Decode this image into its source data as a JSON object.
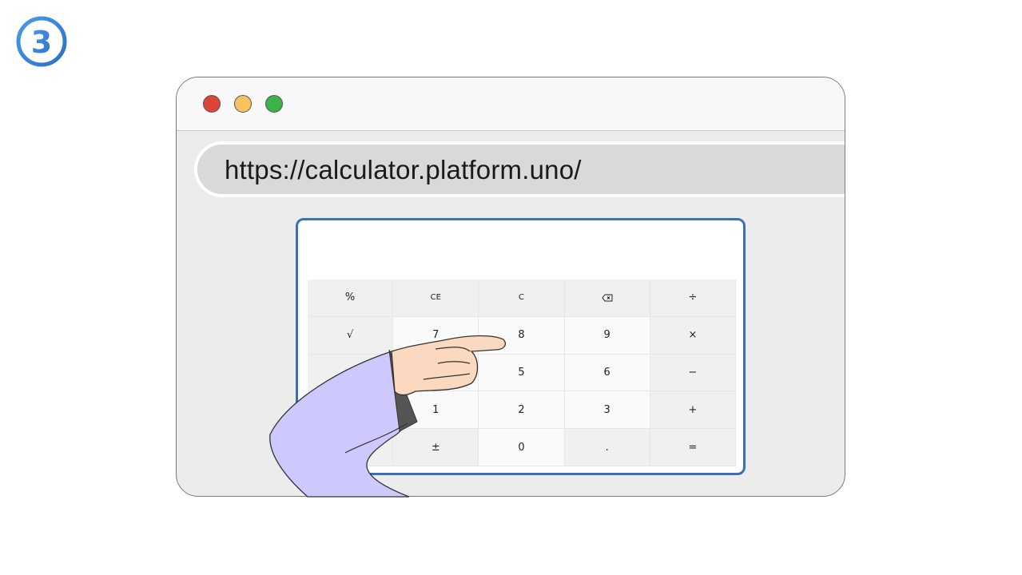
{
  "step": {
    "number": "3",
    "color": "#3a83d8"
  },
  "browser": {
    "window_controls": [
      {
        "name": "close",
        "color": "#db4437"
      },
      {
        "name": "minimize",
        "color": "#f7c35e"
      },
      {
        "name": "maximize",
        "color": "#3cb24a"
      }
    ],
    "address": "https://calculator.platform.uno/"
  },
  "calculator": {
    "accent": "#3d6fb5",
    "keys": {
      "percent": "%",
      "ce": "CE",
      "c": "C",
      "backspace": "backspace-icon",
      "divide": "÷",
      "sqrt": "√",
      "seven": "7",
      "eight": "8",
      "nine": "9",
      "multiply": "×",
      "four": "",
      "five": "5",
      "six": "6",
      "minus": "−",
      "blank": "",
      "one": "1",
      "two": "2",
      "three": "3",
      "plus": "+",
      "blank2": "",
      "plusminus": "±",
      "zero": "0",
      "decimal": ".",
      "equals": "="
    }
  },
  "illustration": {
    "hand_sleeve_color": "#cdc9ff",
    "hand_skin_color": "#fbd8c0"
  }
}
